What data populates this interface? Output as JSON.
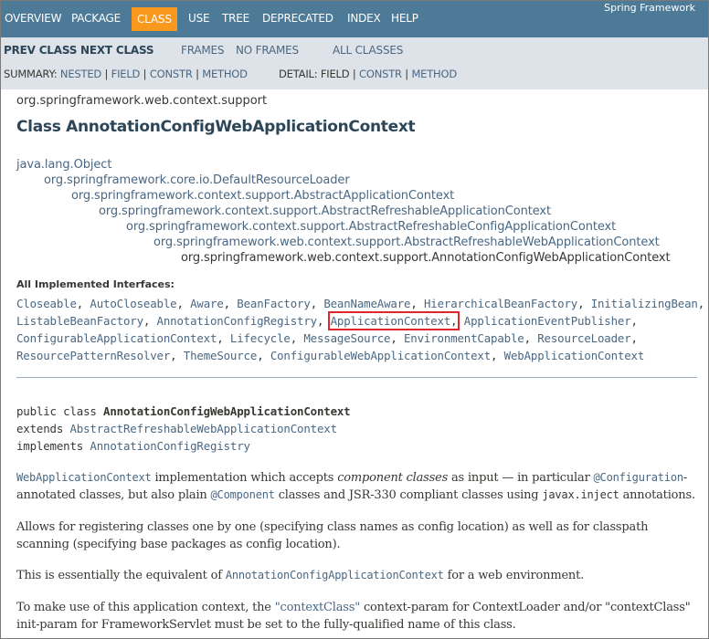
{
  "topnav": {
    "items": [
      "OVERVIEW",
      "PACKAGE",
      "CLASS",
      "USE",
      "TREE",
      "DEPRECATED",
      "INDEX",
      "HELP"
    ],
    "active": "CLASS",
    "brand": "Spring Framework"
  },
  "subnav": {
    "prev_class": "PREV CLASS",
    "next_class": "NEXT CLASS",
    "frames": "FRAMES",
    "no_frames": "NO FRAMES",
    "all_classes": "ALL CLASSES",
    "summary_label": "SUMMARY:",
    "summary_links": [
      "NESTED",
      "FIELD",
      "CONSTR",
      "METHOD"
    ],
    "detail_label": "DETAIL:",
    "detail_field": "FIELD",
    "detail_links": [
      "CONSTR",
      "METHOD"
    ],
    "separator": "|"
  },
  "package_name": "org.springframework.web.context.support",
  "class_title": "Class AnnotationConfigWebApplicationContext",
  "inheritance": [
    "java.lang.Object",
    "org.springframework.core.io.DefaultResourceLoader",
    "org.springframework.context.support.AbstractApplicationContext",
    "org.springframework.context.support.AbstractRefreshableApplicationContext",
    "org.springframework.context.support.AbstractRefreshableConfigApplicationContext",
    "org.springframework.web.context.support.AbstractRefreshableWebApplicationContext",
    "org.springframework.web.context.support.AnnotationConfigWebApplicationContext"
  ],
  "interfaces_heading": "All Implemented Interfaces:",
  "interfaces": [
    "Closeable",
    "AutoCloseable",
    "Aware",
    "BeanFactory",
    "BeanNameAware",
    "HierarchicalBeanFactory",
    "InitializingBean",
    "ListableBeanFactory",
    "AnnotationConfigRegistry",
    "ApplicationContext",
    "ApplicationEventPublisher",
    "ConfigurableApplicationContext",
    "Lifecycle",
    "MessageSource",
    "EnvironmentCapable",
    "ResourceLoader",
    "ResourcePatternResolver",
    "ThemeSource",
    "ConfigurableWebApplicationContext",
    "WebApplicationContext"
  ],
  "highlighted_interface": "ApplicationContext",
  "signature": {
    "line1_prefix": "public class ",
    "line1_name": "AnnotationConfigWebApplicationContext",
    "line2_prefix": "extends ",
    "line2_link": "AbstractRefreshableWebApplicationContext",
    "line3_prefix": "implements ",
    "line3_link": "AnnotationConfigRegistry"
  },
  "description": {
    "p1": {
      "link1": "WebApplicationContext",
      "text1": " implementation which accepts ",
      "em1": "component classes",
      "text2": " as input — in particular ",
      "code1": "@Configuration",
      "text3": "-annotated classes, but also plain ",
      "code2": "@Component",
      "text4": " classes and JSR-330 compliant classes using ",
      "code3": "javax.inject",
      "text5": " annotations."
    },
    "p2": "Allows for registering classes one by one (specifying class names as config location) as well as for classpath scanning (specifying base packages as config location).",
    "p3": {
      "text1": "This is essentially the equivalent of ",
      "code1": "AnnotationConfigApplicationContext",
      "text2": " for a web environment."
    },
    "p4": {
      "text1": "To make use of this application context, the ",
      "link1": "\"contextClass\"",
      "text2": " context-param for ContextLoader and/or \"contextClass\" init-param for FrameworkServlet must be set to the fully-qualified name of this class."
    }
  },
  "colors": {
    "nav_bg": "#4d7a97",
    "nav_active": "#f8981d",
    "subnav_bg": "#dee3e9",
    "link": "#4a6782",
    "highlight_box": "#e0252b"
  }
}
